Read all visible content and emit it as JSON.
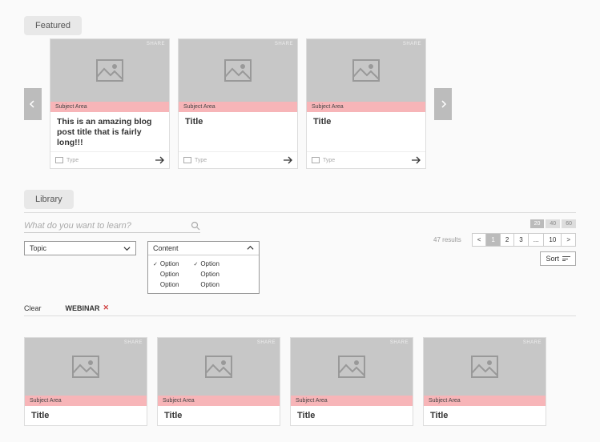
{
  "featured": {
    "tab_label": "Featured",
    "share_label": "SHARE",
    "subject_label": "Subject Area",
    "type_label": "Type",
    "cards": [
      {
        "title": "This is an amazing blog post title that is fairly long!!!"
      },
      {
        "title": "Title"
      },
      {
        "title": "Title"
      }
    ]
  },
  "library": {
    "tab_label": "Library",
    "search_placeholder": "What do you want to learn?",
    "topic_label": "Topic",
    "content_label": "Content",
    "option_label": "Option",
    "clear_label": "Clear",
    "chip_label": "WEBINAR",
    "results_count": "47",
    "results_word": "results",
    "page_sizes": [
      "20",
      "40",
      "60"
    ],
    "pager": {
      "prev": "<",
      "next": ">",
      "pages": [
        "1",
        "2",
        "3"
      ],
      "ellipsis": "...",
      "last": "10"
    },
    "sort_label": "Sort",
    "share_label": "SHARE",
    "subject_label": "Subject Area",
    "cards": [
      {
        "title": "Title"
      },
      {
        "title": "Title"
      },
      {
        "title": "Title"
      },
      {
        "title": "Title"
      }
    ]
  }
}
